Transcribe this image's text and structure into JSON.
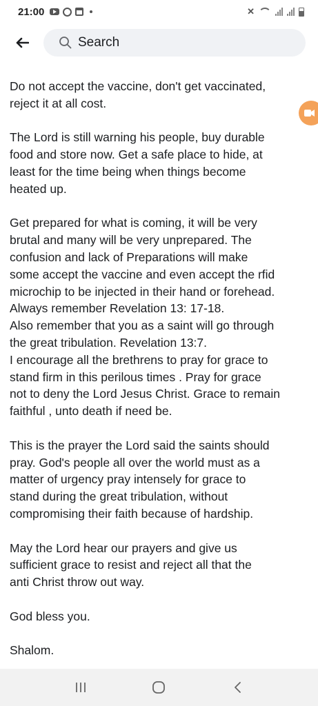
{
  "status_bar": {
    "time": "21:00",
    "left_icons": [
      "youtube-icon",
      "whatsapp-icon",
      "calendar-icon",
      "dot-icon"
    ],
    "right_icons": [
      "mute-icon",
      "wifi-icon",
      "signal-icon",
      "signal-icon",
      "battery-icon"
    ]
  },
  "top_bar": {
    "search_label": "Search"
  },
  "post": {
    "paragraphs": [
      {
        "lines": [
          "Do not accept the vaccine, don't get vaccinated,",
          "reject it at all cost."
        ]
      },
      {
        "lines": [
          "The Lord is still warning his people, buy durable",
          "food and store now. Get a safe place to hide, at",
          "least for the time being when things become",
          "heated up."
        ]
      },
      {
        "lines": [
          "Get prepared for what is coming, it will be very",
          "brutal and many will be very unprepared. The",
          "confusion and lack of Preparations will make",
          "some accept the vaccine and even accept the rfid",
          "microchip to be injected in their hand or forehead.",
          "Always remember Revelation 13: 17-18.",
          "Also remember that you as a saint will go through",
          "the great tribulation. Revelation 13:7.",
          "I encourage all the brethrens to pray for grace to",
          "stand firm in this perilous times . Pray for grace",
          "not to deny the Lord Jesus Christ. Grace to remain",
          "faithful , unto death if need be."
        ]
      },
      {
        "lines": [
          "This is the prayer the Lord said the saints should",
          "pray. God's people all over the world must as a",
          "matter of urgency pray intensely for grace to",
          "stand during the great tribulation, without",
          "compromising their faith because of hardship."
        ]
      },
      {
        "lines": [
          "May the Lord hear our prayers and give us",
          "sufficient grace to resist and reject all that the",
          "anti Christ throw out way."
        ]
      },
      {
        "lines": [
          "God bless you."
        ]
      },
      {
        "lines": [
          "Shalom."
        ]
      }
    ]
  },
  "floating_bubble": {
    "icon": "video-icon",
    "color": "#f4a259"
  },
  "nav_bar": {
    "buttons": [
      "recent-apps-icon",
      "home-icon",
      "back-icon"
    ]
  }
}
